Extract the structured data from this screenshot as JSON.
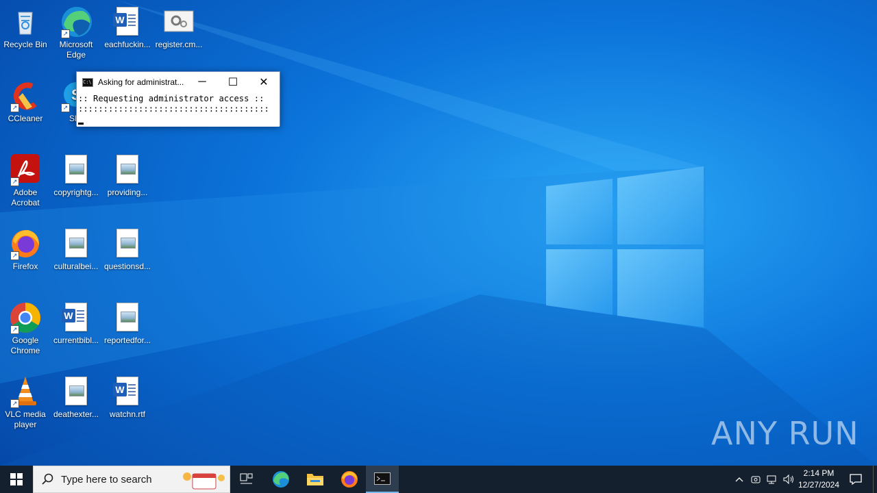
{
  "desktop": {
    "icons": [
      {
        "label": "Recycle Bin"
      },
      {
        "label": "Microsoft Edge"
      },
      {
        "label": "eachfuckin..."
      },
      {
        "label": "register.cm..."
      },
      {
        "label": "CCleaner"
      },
      {
        "label": "Sky"
      },
      {
        "label": "Adobe Acrobat"
      },
      {
        "label": "copyrightg..."
      },
      {
        "label": "providing..."
      },
      {
        "label": "Firefox"
      },
      {
        "label": "culturalbei..."
      },
      {
        "label": "questionsd..."
      },
      {
        "label": "Google Chrome"
      },
      {
        "label": "currentbibl..."
      },
      {
        "label": "reportedfor..."
      },
      {
        "label": "VLC media player"
      },
      {
        "label": "deathexter..."
      },
      {
        "label": "watchn.rtf"
      }
    ]
  },
  "console": {
    "title": "Asking for administrat...",
    "line1": ":: Requesting administrator access ::",
    "line2": "::::::::::::::::::::::::::::::::::::::"
  },
  "taskbar": {
    "search_placeholder": "Type here to search",
    "time": "2:14 PM",
    "date": "12/27/2024"
  },
  "watermark": "ANY RUN",
  "colors": {
    "wallpaper": "#0a63c9",
    "taskbar": "#15202e"
  }
}
